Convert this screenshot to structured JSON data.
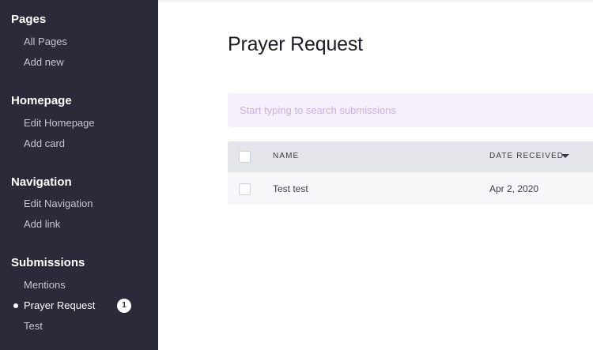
{
  "sidebar": {
    "sections": [
      {
        "heading": "Pages",
        "items": [
          "All Pages",
          "Add new"
        ]
      },
      {
        "heading": "Homepage",
        "items": [
          "Edit Homepage",
          "Add card"
        ]
      },
      {
        "heading": "Navigation",
        "items": [
          "Edit Navigation",
          "Add link"
        ]
      },
      {
        "heading": "Submissions",
        "items": [
          "Mentions",
          "Prayer Request",
          "Test"
        ]
      }
    ],
    "active_item": "Prayer Request",
    "active_item_count": "1"
  },
  "main": {
    "title": "Prayer Request",
    "search": {
      "placeholder": "Start typing to search submissions",
      "value": ""
    },
    "table": {
      "columns": [
        "NAME",
        "DATE RECEIVED"
      ],
      "sort_column": "DATE RECEIVED",
      "sort_direction": "descending",
      "rows": [
        {
          "name": "Test test",
          "date_received": "Apr 2, 2020",
          "selected": false
        }
      ]
    }
  },
  "colors": {
    "sidebar_bg": "#2a2a38",
    "search_bg": "#f6f0fd",
    "search_placeholder": "#c6b3e6",
    "table_header_bg": "#e3e5ea",
    "row_bg": "#f8f8fa"
  },
  "icons": [
    "active-dot-icon",
    "sort-caret-down-icon"
  ]
}
